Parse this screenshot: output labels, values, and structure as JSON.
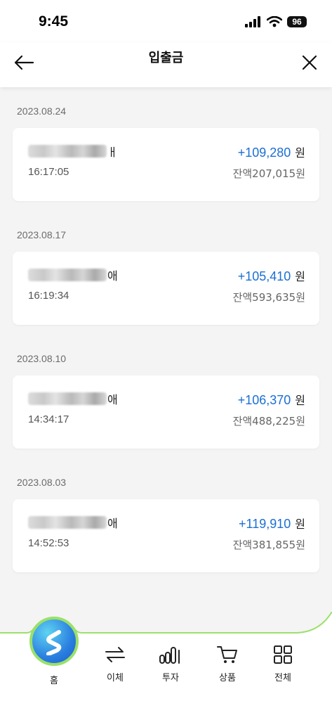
{
  "status": {
    "time": "9:45",
    "battery": "96"
  },
  "header": {
    "title": "입출금"
  },
  "transactions": [
    {
      "date": "2023.08.24",
      "name_suffix": "ㅐ",
      "time": "16:17:05",
      "amount": "+109,280",
      "currency": "원",
      "balance": "잔액207,015원"
    },
    {
      "date": "2023.08.17",
      "name_suffix": "애",
      "time": "16:19:34",
      "amount": "+105,410",
      "currency": "원",
      "balance": "잔액593,635원"
    },
    {
      "date": "2023.08.10",
      "name_suffix": "애",
      "time": "14:34:17",
      "amount": "+106,370",
      "currency": "원",
      "balance": "잔액488,225원"
    },
    {
      "date": "2023.08.03",
      "name_suffix": "애",
      "time": "14:52:53",
      "amount": "+119,910",
      "currency": "원",
      "balance": "잔액381,855원"
    }
  ],
  "tabbar": {
    "items": [
      {
        "label": "홈",
        "icon": "home-logo-icon"
      },
      {
        "label": "이체",
        "icon": "transfer-icon"
      },
      {
        "label": "투자",
        "icon": "invest-chart-icon"
      },
      {
        "label": "상품",
        "icon": "cart-icon"
      },
      {
        "label": "전체",
        "icon": "grid-menu-icon"
      }
    ]
  },
  "colors": {
    "accent": "#1a6fd4",
    "tab_border": "#9be06a"
  }
}
